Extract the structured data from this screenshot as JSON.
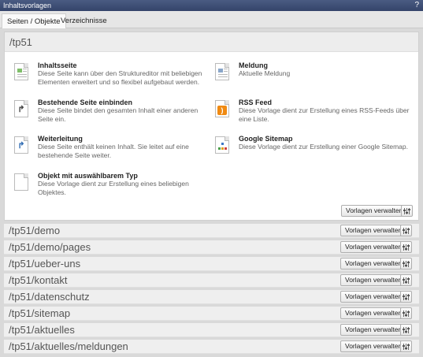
{
  "window": {
    "title": "Inhaltsvorlagen",
    "help_label": "?"
  },
  "tabs": [
    {
      "label": "Seiten / Objekte"
    },
    {
      "label": "Verzeichnisse"
    }
  ],
  "main_panel": {
    "path": "/tp51",
    "templates": [
      {
        "name": "Inhaltsseite",
        "description": "Diese Seite kann über den Struktureditor mit beliebigen Elementen erweitert und so flexibel aufgebaut werden.",
        "icon": "content-page-icon"
      },
      {
        "name": "Meldung",
        "description": "Aktuelle Meldung",
        "icon": "news-page-icon"
      },
      {
        "name": "Bestehende Seite einbinden",
        "description": "Diese Seite bindet den gesamten Inhalt einer anderen Seite ein.",
        "icon": "embed-page-icon"
      },
      {
        "name": "RSS Feed",
        "description": "Diese Vorlage dient zur Erstellung eines RSS-Feeds über eine Liste.",
        "icon": "rss-icon"
      },
      {
        "name": "Weiterleitung",
        "description": "Diese Seite enthält keinen Inhalt. Sie leitet auf eine bestehende Seite weiter.",
        "icon": "redirect-icon"
      },
      {
        "name": "Google Sitemap",
        "description": "Diese Vorlage dient zur Erstellung einer Google Sitemap.",
        "icon": "sitemap-icon"
      },
      {
        "name": "Objekt mit auswählbarem Typ",
        "description": "Diese Vorlage dient zur Erstellung eines beliebigen Objektes.",
        "icon": "blank-object-icon"
      }
    ],
    "manage_label": "Vorlagen verwalten"
  },
  "rows": [
    {
      "path": "/tp51/demo",
      "manage_label": "Vorlagen verwalten"
    },
    {
      "path": "/tp51/demo/pages",
      "manage_label": "Vorlagen verwalten"
    },
    {
      "path": "/tp51/ueber-uns",
      "manage_label": "Vorlagen verwalten"
    },
    {
      "path": "/tp51/kontakt",
      "manage_label": "Vorlagen verwalten"
    },
    {
      "path": "/tp51/datenschutz",
      "manage_label": "Vorlagen verwalten"
    },
    {
      "path": "/tp51/sitemap",
      "manage_label": "Vorlagen verwalten"
    },
    {
      "path": "/tp51/aktuelles",
      "manage_label": "Vorlagen verwalten"
    },
    {
      "path": "/tp51/aktuelles/meldungen",
      "manage_label": "Vorlagen verwalten"
    }
  ],
  "colors": {
    "titlebar": "#3d4e74",
    "rss": "#f08a12",
    "redirect": "#2f6bb3"
  }
}
